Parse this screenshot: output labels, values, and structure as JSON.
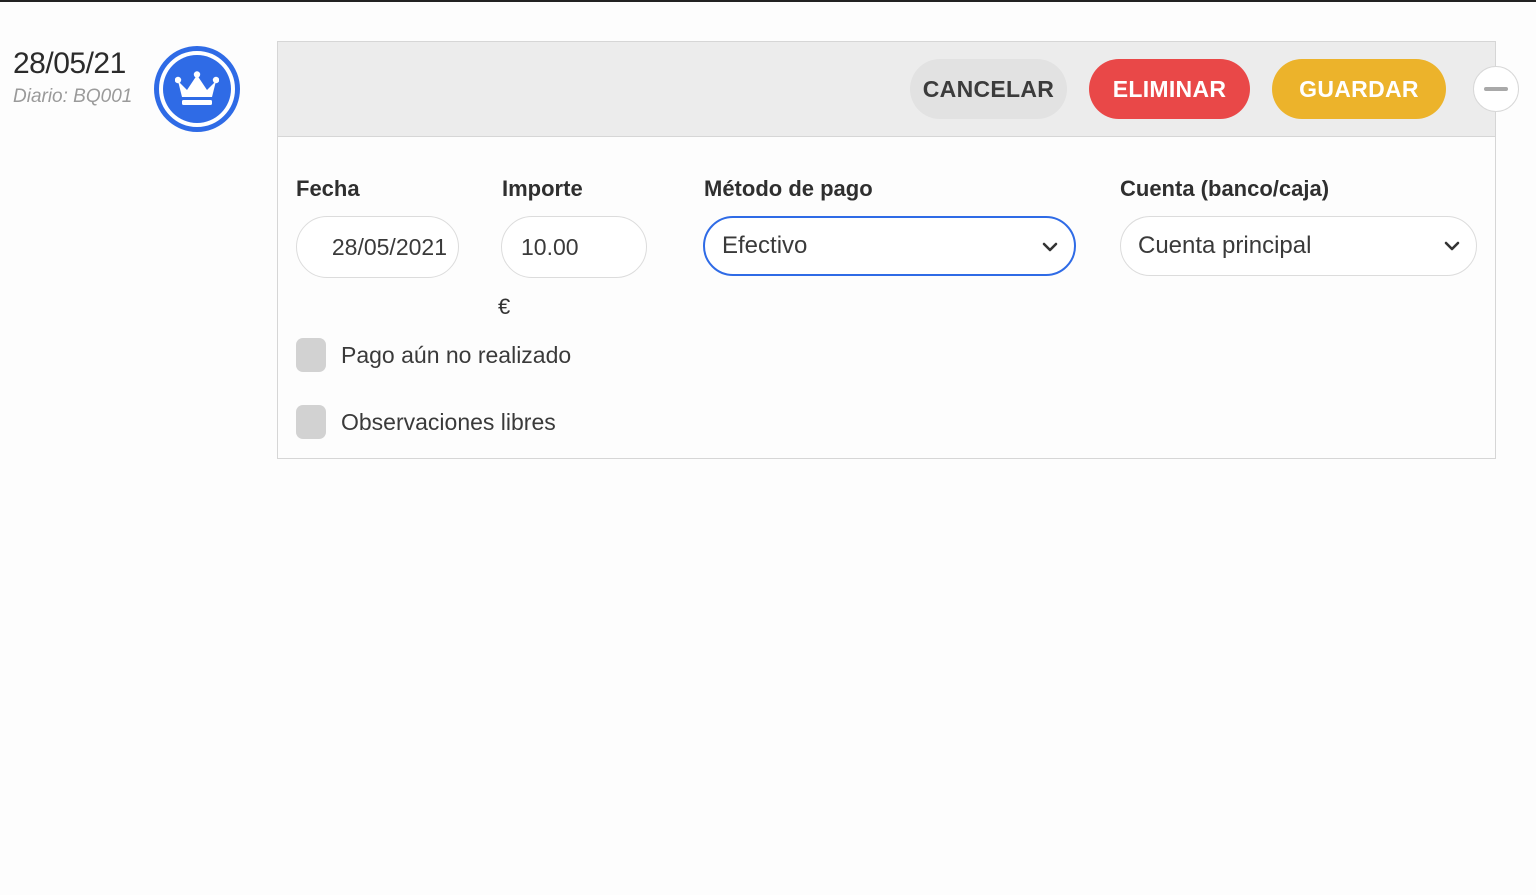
{
  "entry": {
    "date": "28/05/21",
    "journal": "Diario: BQ001",
    "avatar_icon": "crown-icon"
  },
  "toolbar": {
    "cancel_label": "CANCELAR",
    "delete_label": "ELIMINAR",
    "save_label": "GUARDAR",
    "collapse_icon": "minus-icon"
  },
  "form": {
    "date": {
      "label": "Fecha",
      "value": "28/05/2021"
    },
    "amount": {
      "label": "Importe",
      "value": "10.00",
      "currency": "€"
    },
    "payment_method": {
      "label": "Método de pago",
      "selected": "Efectivo"
    },
    "account": {
      "label": "Cuenta (banco/caja)",
      "selected": "Cuenta principal"
    },
    "checkboxes": [
      {
        "label": "Pago aún no realizado",
        "checked": false
      },
      {
        "label": "Observaciones libres",
        "checked": false
      }
    ]
  },
  "colors": {
    "accent": "#2f6be6",
    "delete": "#e94848",
    "save": "#ecb32b",
    "cancel": "#e2e2e2"
  }
}
